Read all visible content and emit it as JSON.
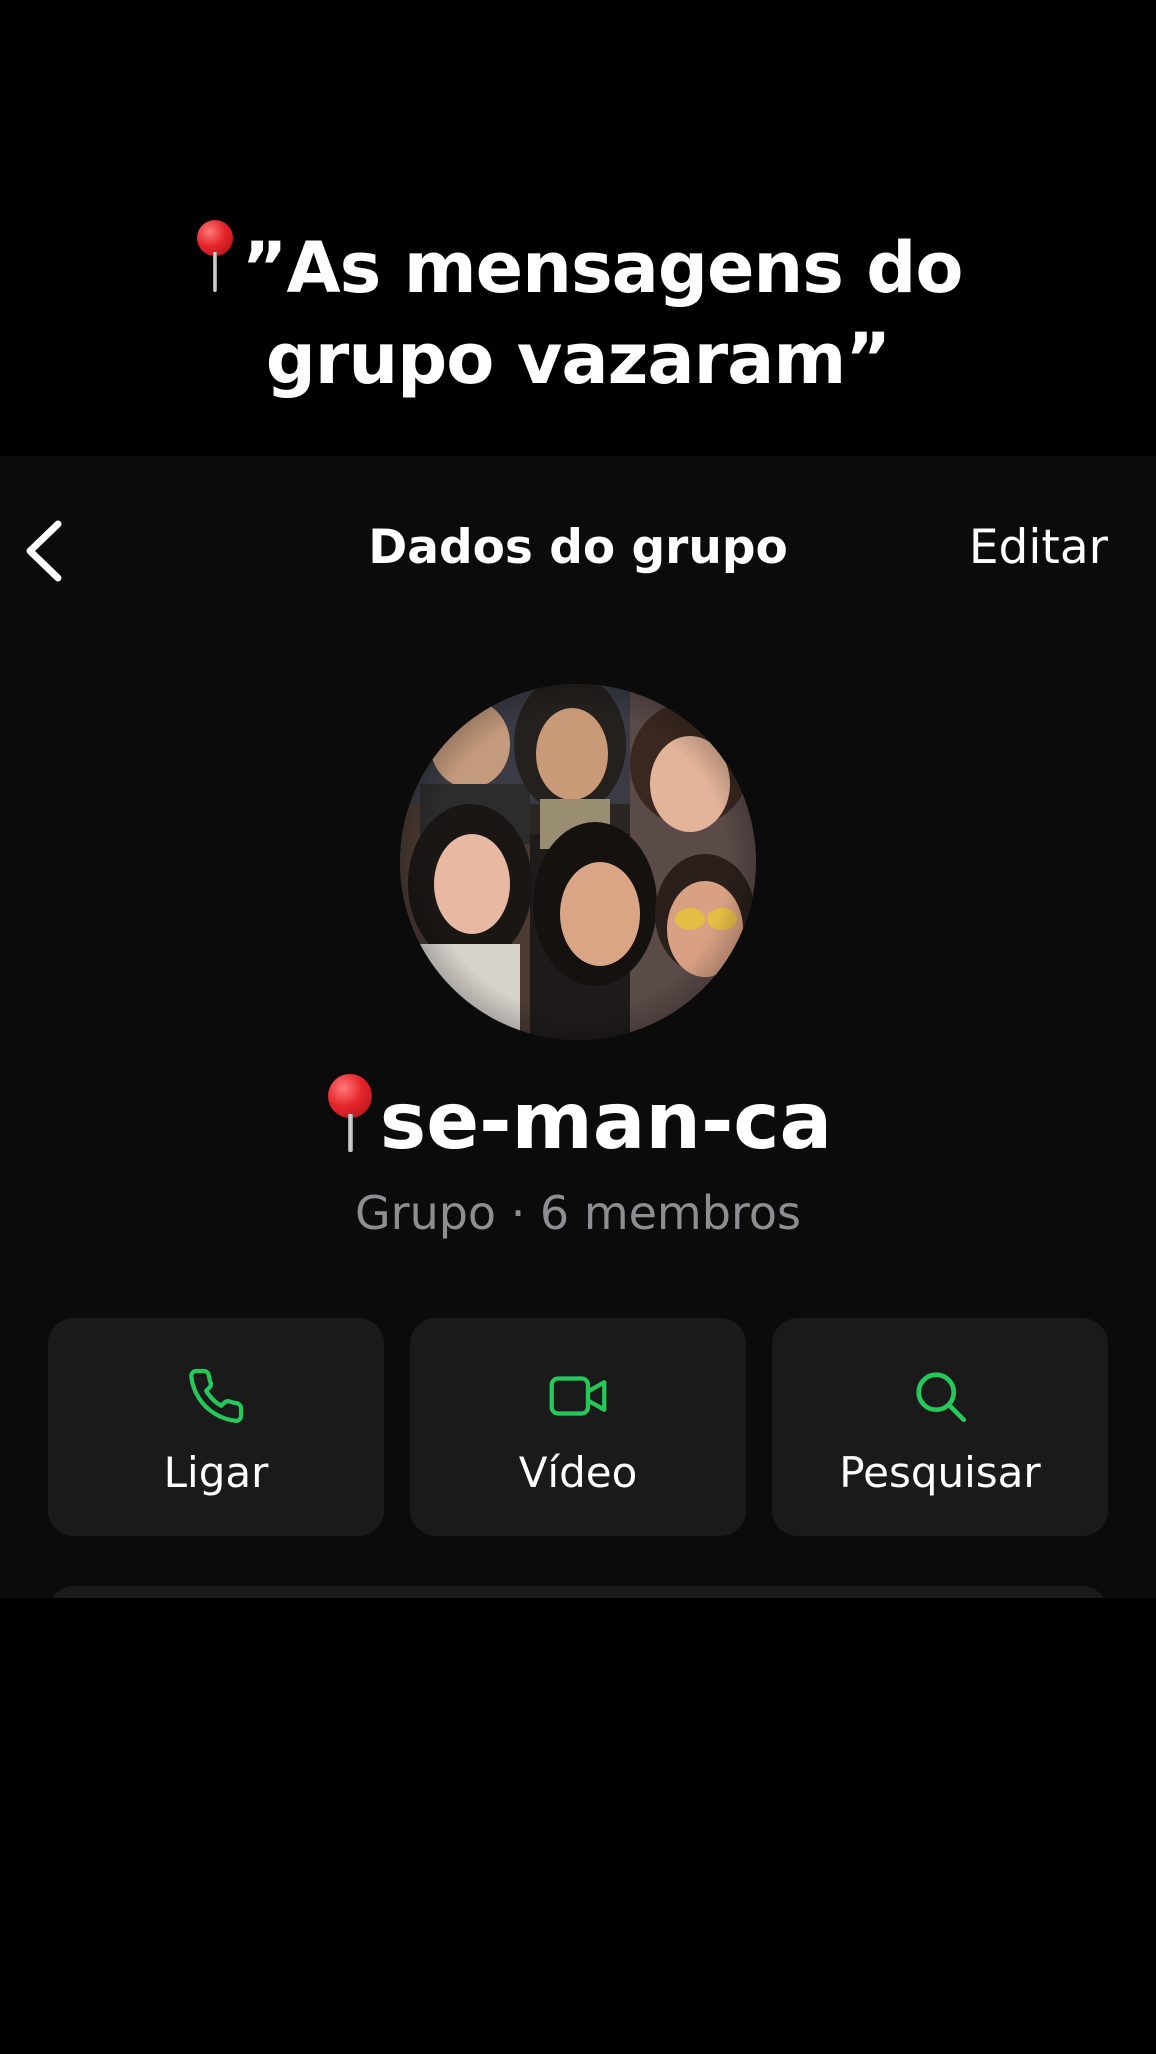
{
  "caption": {
    "line1": "”As mensagens do",
    "line2": "grupo vazaram”",
    "pin_icon": "round-pushpin-icon"
  },
  "header": {
    "back_icon": "chevron-left-icon",
    "title": "Dados do grupo",
    "edit_label": "Editar"
  },
  "group": {
    "name": "se-man-ca",
    "name_icon": "round-pushpin-icon",
    "subtitle": "Grupo · 6 membros"
  },
  "actions": [
    {
      "label": "Ligar",
      "icon": "phone-icon"
    },
    {
      "label": "Vídeo",
      "icon": "video-camera-icon"
    },
    {
      "label": "Pesquisar",
      "icon": "search-icon"
    }
  ],
  "colors": {
    "accent": "#25C95A",
    "background": "#0B0B0B",
    "card": "#1A1A1A",
    "secondary_text": "#8D8D92"
  }
}
